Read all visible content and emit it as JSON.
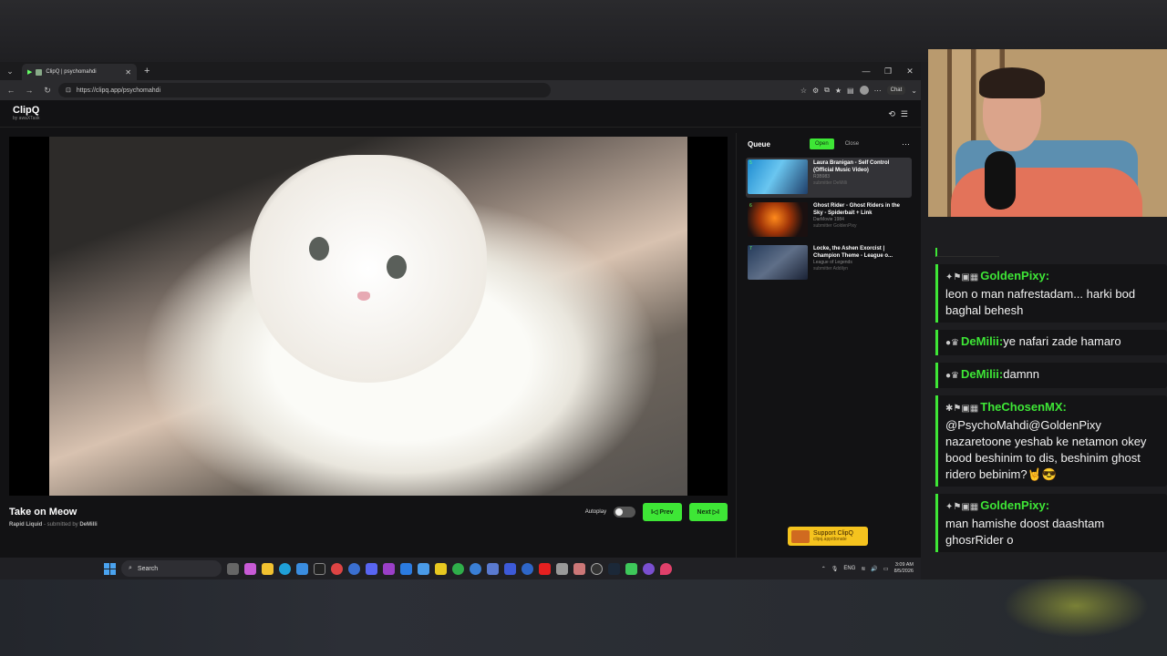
{
  "browser": {
    "tab_title": "ClipQ | psychomahdi",
    "url": "https://clipq.app/psychomahdi",
    "chat_label": "Chat"
  },
  "app": {
    "logo": "ClipQ",
    "logo_sub": "by awaXTask"
  },
  "video": {
    "title": "Take on Meow",
    "channel": "Rapid Liquid",
    "submitted_prefix": " - submitted by ",
    "submitter": "DeMilli"
  },
  "controls": {
    "autoplay_label": "Autoplay",
    "prev_label": "I◁ Prev",
    "next_label": "Next ▷I"
  },
  "queue": {
    "title": "Queue",
    "open_label": "Open",
    "close_label": "Close",
    "items": [
      {
        "num": "5",
        "title": "Laura Branigan - Self Control (Official Music Video)",
        "channel": "R3B983",
        "submitter": "submitter DeMilli"
      },
      {
        "num": "6",
        "title": "Ghost Rider - Ghost Riders in the Sky - Spiderbait + Link",
        "channel": "DarMovie 1984",
        "submitter": "submitter GoldenPixy"
      },
      {
        "num": "7",
        "title": "Locke, the Ashen Exorcist | Champion Theme - League o...",
        "channel": "League of Legends",
        "submitter": "submitter Addilyn"
      }
    ]
  },
  "support": {
    "label": "Support ClipQ",
    "url": "clipq.app/donate"
  },
  "taskbar": {
    "search": "Search",
    "lang": "ENG",
    "time": "3:09 AM",
    "date": "8/5/2026"
  },
  "chat": {
    "messages": [
      {
        "user": "GoldenPixy:",
        "text": "leon o man nafrestadam... harki bod baghal behesh"
      },
      {
        "user": "DeMilii:",
        "text": "ye nafari zade hamaro"
      },
      {
        "user": "DeMilii:",
        "text": "damnn"
      },
      {
        "user": "TheChosenMX:",
        "text": "@PsychoMahdi@GoldenPixy nazaretoone yeshab ke netamon okey bood beshinim to dis, beshinim ghost ridero bebinim?🤘😎"
      },
      {
        "user": "GoldenPixy:",
        "text": "man hamishe doost daashtam ghosrRider o"
      }
    ]
  },
  "colors": {
    "accent": "#3ee636",
    "support": "#f5c31e"
  }
}
